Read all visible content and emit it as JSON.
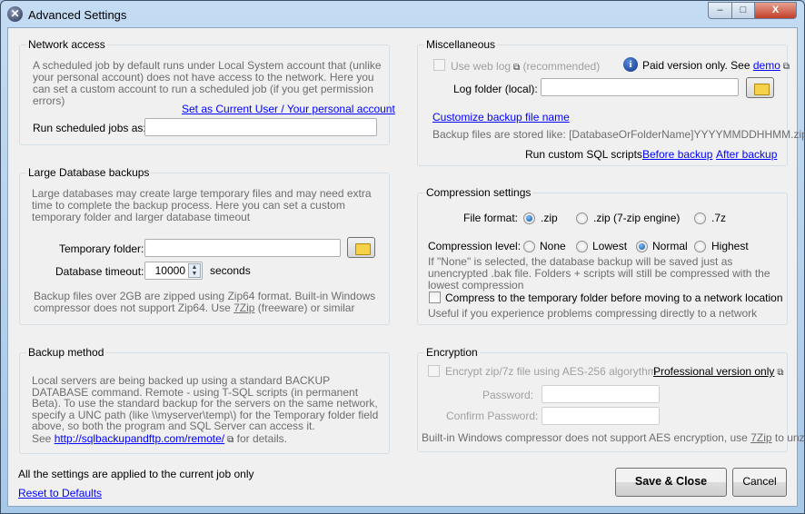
{
  "window": {
    "title": "Advanced Settings",
    "minimize": "‒",
    "maximize": "□",
    "close": "X"
  },
  "network": {
    "title": "Network access",
    "description": "A scheduled job by default runs under Local System account that (unlike your personal account) does not have access to the network. Here you can set a custom account to run a scheduled job (if you get permission errors)",
    "set_current_user_link": "Set as Current User / Your personal account",
    "run_as_label": "Run scheduled jobs as:",
    "run_as_value": ""
  },
  "large_db": {
    "title": "Large Database backups",
    "description": "Large databases may create large temporary files and may need extra time to complete the backup process. Here you can set a custom temporary folder and larger database timeout",
    "temp_folder_label": "Temporary folder:",
    "temp_folder_value": "",
    "timeout_label": "Database timeout:",
    "timeout_value": "10000",
    "timeout_unit": "seconds",
    "note_prefix": "Backup files over 2GB are zipped using Zip64 format. Built-in Windows compressor does not support Zip64. Use ",
    "note_link": "7Zip",
    "note_suffix": " (freeware) or similar"
  },
  "backup_method": {
    "title": "Backup method",
    "description": "Local servers are being backed up using a standard BACKUP DATABASE command. Remote - using T-SQL scripts (in permanent Beta). To use the standard backup for the servers on the same network, specify a UNC path (like \\\\myserver\\temp\\) for the Temporary folder field above, so both the program and SQL Server can access it.",
    "see_prefix": "See",
    "link": "http://sqlbackupandftp.com/remote/",
    "see_suffix": "for details."
  },
  "misc": {
    "title": "Miscellaneous",
    "use_web_log_label": "Use web log",
    "recommended": "(recommended)",
    "paid_note": "Paid version only. See",
    "demo_link": "demo",
    "log_folder_label": "Log folder (local):",
    "log_folder_value": "",
    "customize_link": "Customize backup file name",
    "stored_like": "Backup files are stored like: [DatabaseOrFolderName]YYYYMMDDHHMM.zip",
    "custom_sql_label": "Run custom SQL scripts:",
    "before_backup_link": "Before backup",
    "after_backup_link": "After backup"
  },
  "compression": {
    "title": "Compression settings",
    "format_label": "File format:",
    "formats": [
      {
        "label": ".zip",
        "selected": true
      },
      {
        "label": ".zip (7-zip engine)",
        "selected": false
      },
      {
        "label": ".7z",
        "selected": false
      }
    ],
    "level_label": "Compression level:",
    "levels": [
      {
        "label": "None",
        "selected": false
      },
      {
        "label": "Lowest",
        "selected": false
      },
      {
        "label": "Normal",
        "selected": true
      },
      {
        "label": "Highest",
        "selected": false
      }
    ],
    "none_note": "If \"None\" is selected, the database backup will be saved just as unencrypted .bak file. Folders + scripts will still be compressed with the lowest compression",
    "compress_temp_label": "Compress to the temporary folder before moving to a network location",
    "compress_temp_checked": false,
    "compress_temp_note": "Useful if you experience problems compressing directly to a network"
  },
  "encryption": {
    "title": "Encryption",
    "encrypt_label": "Encrypt zip/7z file using AES-256 algorythm",
    "pro_link": "Professional version only",
    "password_label": "Password:",
    "confirm_label": "Confirm Password:",
    "note_prefix": "Built-in Windows compressor does not support AES encryption, use ",
    "note_link": "7Zip",
    "note_suffix": " to unzip"
  },
  "footer": {
    "applied_note": "All the settings are applied to the current job only",
    "reset_link": "Reset to Defaults",
    "save_button": "Save & Close",
    "cancel_button": "Cancel"
  }
}
